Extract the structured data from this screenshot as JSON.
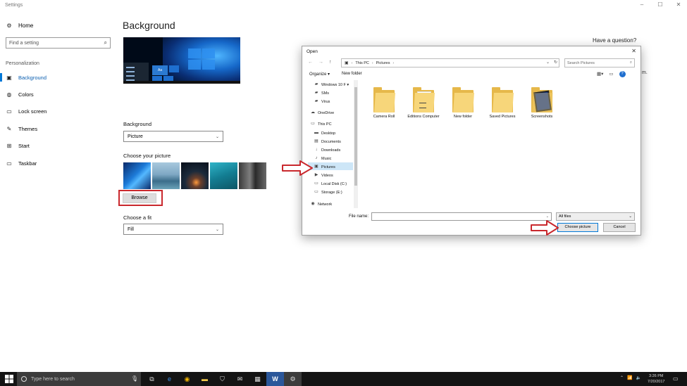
{
  "window": {
    "title": "Settings",
    "controls": [
      "–",
      "☐",
      "✕"
    ]
  },
  "sidebar": {
    "home_label": "Home",
    "search_placeholder": "Find a setting",
    "section_label": "Personalization",
    "items": [
      {
        "label": "Background",
        "icon": "image-icon",
        "active": true
      },
      {
        "label": "Colors",
        "icon": "palette-icon"
      },
      {
        "label": "Lock screen",
        "icon": "monitor-lock-icon"
      },
      {
        "label": "Themes",
        "icon": "themes-brush-icon"
      },
      {
        "label": "Start",
        "icon": "start-grid-icon"
      },
      {
        "label": "Taskbar",
        "icon": "taskbar-icon"
      }
    ]
  },
  "main": {
    "title": "Background",
    "preview_tile_label": "Aa",
    "background_label": "Background",
    "background_value": "Picture",
    "choose_picture_label": "Choose your picture",
    "browse_label": "Browse",
    "fit_label": "Choose a fit",
    "fit_value": "Fill",
    "question": "Have a question?",
    "edge_text": "m."
  },
  "dialog": {
    "title": "Open",
    "breadcrumb": [
      "This PC",
      "Pictures"
    ],
    "search_placeholder": "Search Pictures",
    "organize_label": "Organize ▾",
    "new_folder_label": "New folder",
    "tree": [
      {
        "label": "Windows 10 F ▾",
        "icon": "folder-icon"
      },
      {
        "label": "SMs",
        "icon": "folder-icon"
      },
      {
        "label": "Virus",
        "icon": "folder-icon"
      },
      {
        "label": "OneDrive",
        "icon": "cloud-icon"
      },
      {
        "label": "This PC",
        "icon": "computer-icon"
      },
      {
        "label": "Desktop",
        "icon": "desktop-icon"
      },
      {
        "label": "Documents",
        "icon": "documents-icon"
      },
      {
        "label": "Downloads",
        "icon": "download-icon"
      },
      {
        "label": "Music",
        "icon": "music-icon"
      },
      {
        "label": "Pictures",
        "icon": "pictures-icon",
        "selected": true
      },
      {
        "label": "Videos",
        "icon": "video-icon"
      },
      {
        "label": "Local Disk (C:)",
        "icon": "disk-icon"
      },
      {
        "label": "Storage (E:)",
        "icon": "disk-icon"
      },
      {
        "label": "Network",
        "icon": "network-icon"
      }
    ],
    "folders": [
      {
        "label": "Camera Roll",
        "kind": "plain"
      },
      {
        "label": "Editions Computer",
        "kind": "paper"
      },
      {
        "label": "New folder",
        "kind": "plain"
      },
      {
        "label": "Saved Pictures",
        "kind": "plain"
      },
      {
        "label": "Screenshots",
        "kind": "device"
      }
    ],
    "file_name_label": "File name:",
    "file_name_value": "",
    "file_type_value": "All files",
    "choose_label": "Choose picture",
    "cancel_label": "Cancel"
  },
  "taskbar": {
    "search_placeholder": "Type here to search",
    "apps": [
      {
        "name": "task-view-icon",
        "glyph": "⧉"
      },
      {
        "name": "edge-icon",
        "glyph": "e"
      },
      {
        "name": "chrome-icon",
        "glyph": "◉"
      },
      {
        "name": "file-explorer-icon",
        "glyph": "▬"
      },
      {
        "name": "store-icon",
        "glyph": "⛉"
      },
      {
        "name": "mail-icon",
        "glyph": "✉"
      },
      {
        "name": "calculator-icon",
        "glyph": "▦"
      },
      {
        "name": "word-icon",
        "glyph": "W"
      },
      {
        "name": "settings-gear-icon",
        "glyph": "⚙",
        "active": true
      }
    ],
    "time": "3:26 PM",
    "date": "7/20/2017"
  },
  "colors": {
    "accent": "#0078d7",
    "highlight": "#c9282d",
    "taskbar": "#141414"
  }
}
